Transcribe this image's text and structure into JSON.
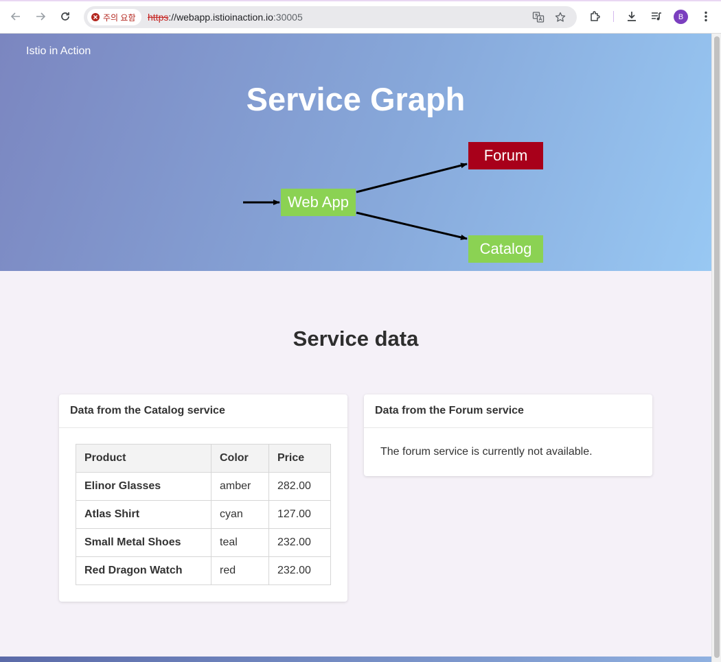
{
  "browser": {
    "security_chip": "주의 요함",
    "url": {
      "scheme": "https",
      "rest": "://webapp.istioinaction.io",
      "port": ":30005"
    },
    "avatar_initial": "B"
  },
  "page": {
    "brand": "Istio in Action",
    "hero_title": "Service Graph",
    "graph": {
      "nodes": [
        {
          "id": "webapp",
          "label": "Web App",
          "status": "available",
          "color": "#8bd253"
        },
        {
          "id": "forum",
          "label": "Forum",
          "status": "unavailable",
          "color": "#a8001a"
        },
        {
          "id": "catalog",
          "label": "Catalog",
          "status": "available",
          "color": "#8bd253"
        }
      ]
    },
    "section_title": "Service data",
    "catalog_card": {
      "title": "Data from the Catalog service",
      "columns": [
        "Product",
        "Color",
        "Price"
      ],
      "rows": [
        {
          "product": "Elinor Glasses",
          "color": "amber",
          "price": "282.00"
        },
        {
          "product": "Atlas Shirt",
          "color": "cyan",
          "price": "127.00"
        },
        {
          "product": "Small Metal Shoes",
          "color": "teal",
          "price": "232.00"
        },
        {
          "product": "Red Dragon Watch",
          "color": "red",
          "price": "232.00"
        }
      ]
    },
    "forum_card": {
      "title": "Data from the Forum service",
      "message": "The forum service is currently not available."
    }
  }
}
